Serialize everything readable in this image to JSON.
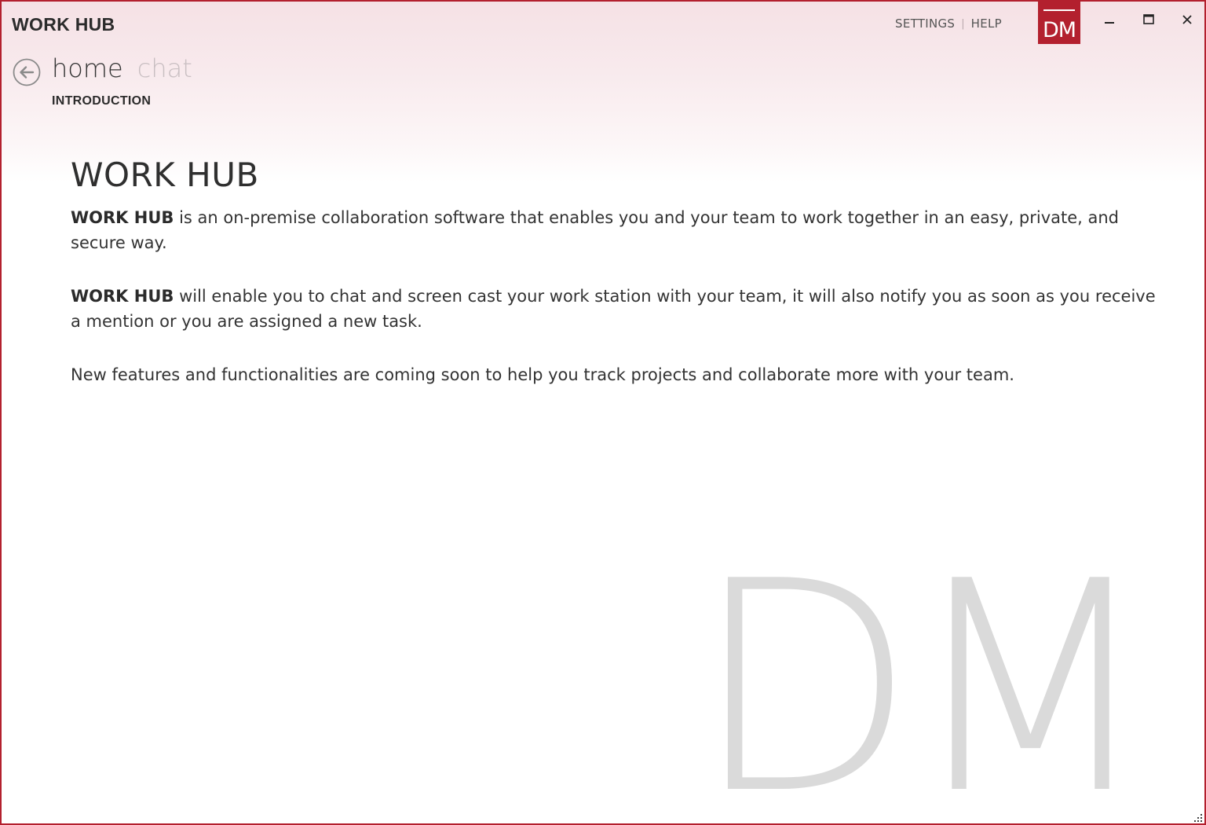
{
  "titlebar": {
    "app_title": "WORK HUB",
    "settings_label": "SETTINGS",
    "separator": "|",
    "help_label": "HELP",
    "avatar_initials": "DM"
  },
  "navigation": {
    "tabs": [
      {
        "label": "home",
        "active": true
      },
      {
        "label": "chat",
        "active": false
      }
    ],
    "section_title": "INTRODUCTION"
  },
  "main": {
    "heading": "WORK HUB",
    "paragraphs": [
      {
        "bold": "WORK HUB",
        "text": " is an on-premise collaboration software that enables you and your team to work together in an easy, private, and secure way."
      },
      {
        "bold": "WORK HUB",
        "text": " will enable you to chat and screen cast your work station with your team, it will also notify you as soon as you receive a mention or you are assigned a new task."
      },
      {
        "bold": "",
        "text": "New features and functionalities are coming soon to help you track projects and collaborate more with your team."
      }
    ]
  },
  "watermark": "DM",
  "colors": {
    "accent": "#b3202e",
    "watermark": "#dadada",
    "inactive_tab": "#c9bfc2"
  }
}
